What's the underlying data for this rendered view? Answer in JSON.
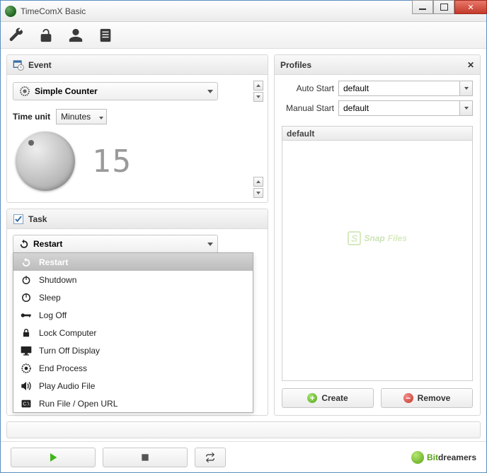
{
  "window": {
    "title": "TimeComX Basic"
  },
  "event": {
    "header": "Event",
    "counter_type": "Simple Counter",
    "time_unit_label": "Time unit",
    "time_unit_value": "Minutes",
    "counter_value": "15"
  },
  "task": {
    "header": "Task",
    "selected": "Restart",
    "options": [
      {
        "key": "restart",
        "label": "Restart"
      },
      {
        "key": "shutdown",
        "label": "Shutdown"
      },
      {
        "key": "sleep",
        "label": "Sleep"
      },
      {
        "key": "logoff",
        "label": "Log Off"
      },
      {
        "key": "lock",
        "label": "Lock Computer"
      },
      {
        "key": "display",
        "label": "Turn Off Display"
      },
      {
        "key": "endproc",
        "label": "End Process"
      },
      {
        "key": "audio",
        "label": "Play Audio File"
      },
      {
        "key": "runfile",
        "label": "Run File / Open URL"
      }
    ]
  },
  "profiles": {
    "header": "Profiles",
    "auto_start_label": "Auto Start",
    "auto_start_value": "default",
    "manual_start_label": "Manual Start",
    "manual_start_value": "default",
    "list_header": "default",
    "create_label": "Create",
    "remove_label": "Remove"
  },
  "watermark": {
    "brand_a": "Snap",
    "brand_b": "Files"
  },
  "footer": {
    "brand_a": "Bit",
    "brand_b": "dreamers"
  }
}
